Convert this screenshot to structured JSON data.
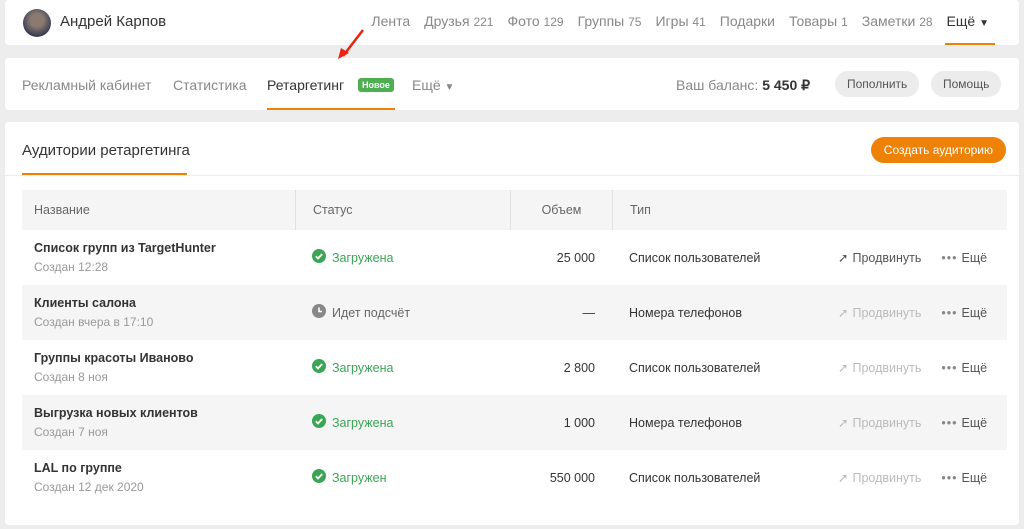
{
  "user": {
    "name": "Андрей Карпов"
  },
  "topnav": [
    {
      "label": "Лента",
      "count": ""
    },
    {
      "label": "Друзья",
      "count": "221"
    },
    {
      "label": "Фото",
      "count": "129"
    },
    {
      "label": "Группы",
      "count": "75"
    },
    {
      "label": "Игры",
      "count": "41"
    },
    {
      "label": "Подарки",
      "count": ""
    },
    {
      "label": "Товары",
      "count": "1"
    },
    {
      "label": "Заметки",
      "count": "28"
    }
  ],
  "topnav_more": "Ещё",
  "subnav": {
    "items": [
      "Рекламный кабинет",
      "Статистика",
      "Ретаргетинг"
    ],
    "badge": "Новое",
    "more": "Ещё",
    "balance_label": "Ваш баланс:",
    "balance_value": "5 450 ₽",
    "topup": "Пополнить",
    "help": "Помощь"
  },
  "section": {
    "title": "Аудитории ретаргетинга",
    "create": "Создать аудиторию"
  },
  "table": {
    "headers": [
      "Название",
      "Статус",
      "Объем",
      "Тип"
    ],
    "promote": "Продвинуть",
    "more": "Ещё",
    "rows": [
      {
        "name": "Список групп из TargetHunter",
        "date": "Создан 12:28",
        "status": "Загружена",
        "status_type": "ok",
        "volume": "25 000",
        "type": "Список пользователей",
        "promote_enabled": true
      },
      {
        "name": "Клиенты салона",
        "date": "Создан вчера в 17:10",
        "status": "Идет подсчёт",
        "status_type": "wait",
        "volume": "—",
        "type": "Номера телефонов",
        "promote_enabled": false
      },
      {
        "name": "Группы красоты Иваново",
        "date": "Создан 8 ноя",
        "status": "Загружена",
        "status_type": "ok",
        "volume": "2 800",
        "type": "Список пользователей",
        "promote_enabled": false
      },
      {
        "name": "Выгрузка новых клиентов",
        "date": "Создан 7 ноя",
        "status": "Загружена",
        "status_type": "ok",
        "volume": "1 000",
        "type": "Номера телефонов",
        "promote_enabled": false
      },
      {
        "name": "LAL по группе",
        "date": "Создан 12 дек 2020",
        "status": "Загружен",
        "status_type": "ok",
        "volume": "550 000",
        "type": "Список пользователей",
        "promote_enabled": false
      }
    ]
  },
  "colors": {
    "accent": "#ee8208",
    "ok": "#3aa655",
    "badge": "#4caf50"
  }
}
